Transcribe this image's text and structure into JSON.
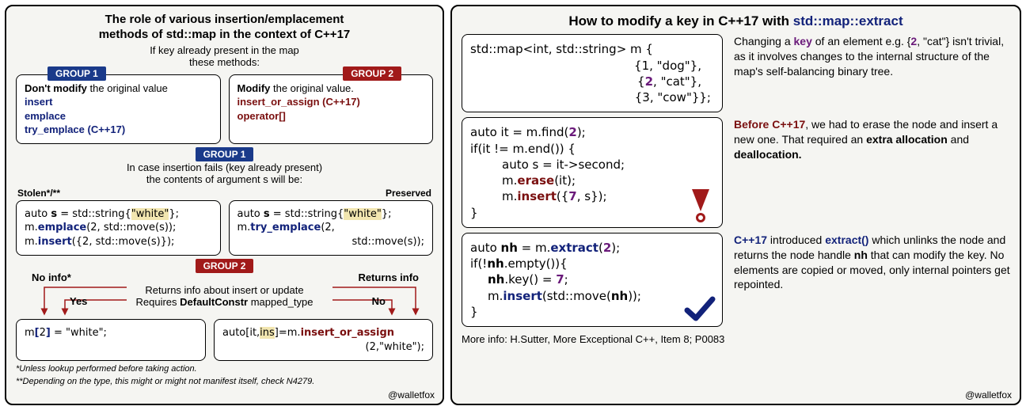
{
  "left": {
    "title_l1": "The role of various insertion/emplacement",
    "title_l2": "methods of std::map in the context of C++17",
    "subtitle_l1": "If key already present in the map",
    "subtitle_l2": "these methods:",
    "group1": "GROUP 1",
    "group2": "GROUP 2",
    "box1_head": "Don't modify",
    "box1_tail": " the original value",
    "box1_items": [
      "insert",
      "emplace",
      "try_emplace (C++17)"
    ],
    "box2_head": "Modify",
    "box2_tail": " the original value.",
    "box2_items": [
      "insert_or_assign (C++17)",
      "operator[]"
    ],
    "g1_sub_l1": "In case insertion fails (key already present)",
    "g1_sub_l2": "the contents of argument s will be:",
    "stolen": "Stolen*/**",
    "preserved": "Preserved",
    "code_stolen_l1a": "auto ",
    "code_stolen_l1b": "s",
    "code_stolen_l1c": " = std::string{",
    "code_stolen_l1d": "\"white\"",
    "code_stolen_l1e": "};",
    "code_stolen_l2a": "m.",
    "code_stolen_l2b": "emplace",
    "code_stolen_l2c": "(2, std::move(s));",
    "code_stolen_l3a": "m.",
    "code_stolen_l3b": "insert",
    "code_stolen_l3c": "({2, std::move(s)});",
    "code_pres_l1a": "auto ",
    "code_pres_l1b": "s",
    "code_pres_l1c": " = std::string{",
    "code_pres_l1d": "\"white\"",
    "code_pres_l1e": "};",
    "code_pres_l2a": "m.",
    "code_pres_l2b": "try_emplace",
    "code_pres_l2c": "(2,",
    "code_pres_l3": "std::move(s));",
    "noinfo": "No info*",
    "returnsinfo": "Returns info",
    "yes": "Yes",
    "no": "No",
    "g2_line1": "Returns info about insert or update",
    "g2_line2a": "Requires ",
    "g2_line2b": "DefaultConstr",
    "g2_line2c": " mapped_type",
    "code_op_l1a": "m",
    "code_op_l1b": "[",
    "code_op_l1c": "2",
    "code_op_l1d": "]",
    "code_op_l1e": " = \"white\";",
    "code_ioa_l1a": "auto[it,",
    "code_ioa_l1b": "ins",
    "code_ioa_l1c": "]=m.",
    "code_ioa_l1d": "insert_or_assign",
    "code_ioa_l2": "(2,\"white\");",
    "foot1": "*Unless lookup performed before taking action.",
    "foot2": "**Depending on the type, this might or might not manifest itself, check N4279.",
    "credit": "@walletfox"
  },
  "right": {
    "title_a": "How to modify a key in C++17 with ",
    "title_b": "std::map::extract",
    "code1_l1": "std::map<int, std::string> m {",
    "code1_l2": "{1, \"dog\"},",
    "code1_l3a": "{",
    "code1_l3b": "2",
    "code1_l3c": ", \"cat\"},",
    "code1_l4": "{3, \"cow\"}};",
    "text1_a": "Changing a ",
    "text1_b": "key",
    "text1_c": " of an element e.g. ",
    "text1_d": "{",
    "text1_e": "2",
    "text1_f": ", \"cat\"} isn't trivial, as it involves changes to the internal structure of the map's self-balancing binary tree.",
    "code2_l1a": "auto it = m.find(",
    "code2_l1b": "2",
    "code2_l1c": ");",
    "code2_l2": "if(it != m.end()) {",
    "code2_l3": "auto s = it->second;",
    "code2_l4a": "m.",
    "code2_l4b": "erase",
    "code2_l4c": "(it);",
    "code2_l5a": "m.",
    "code2_l5b": "insert",
    "code2_l5c": "({",
    "code2_l5d": "7",
    "code2_l5e": ", s});",
    "code2_l6": "}",
    "text2_a": "Before C++17",
    "text2_b": ", we had to erase the node and insert a new one. That required an ",
    "text2_c": "extra allocation",
    "text2_d": " and ",
    "text2_e": "deallocation.",
    "code3_l1a": "auto ",
    "code3_l1b": "nh",
    "code3_l1c": " = m.",
    "code3_l1d": "extract",
    "code3_l1e": "(",
    "code3_l1f": "2",
    "code3_l1g": ");",
    "code3_l2a": "if(!",
    "code3_l2b": "nh",
    "code3_l2c": ".empty()){",
    "code3_l3a": "nh",
    "code3_l3b": ".key() = ",
    "code3_l3c": "7",
    "code3_l3d": ";",
    "code3_l4a": "m.",
    "code3_l4b": "insert",
    "code3_l4c": "(std::move(",
    "code3_l4d": "nh",
    "code3_l4e": "));",
    "code3_l5": "}",
    "text3_a": "C++17",
    "text3_b": " introduced ",
    "text3_c": "extract()",
    "text3_d": " which unlinks the node and returns the node handle ",
    "text3_e": "nh",
    "text3_f": " that can modify the key. No elements are copied or moved, only internal pointers get repointed.",
    "moreinfo": "More info: H.Sutter, More Exceptional C++, Item 8; P0083",
    "credit": "@walletfox"
  }
}
